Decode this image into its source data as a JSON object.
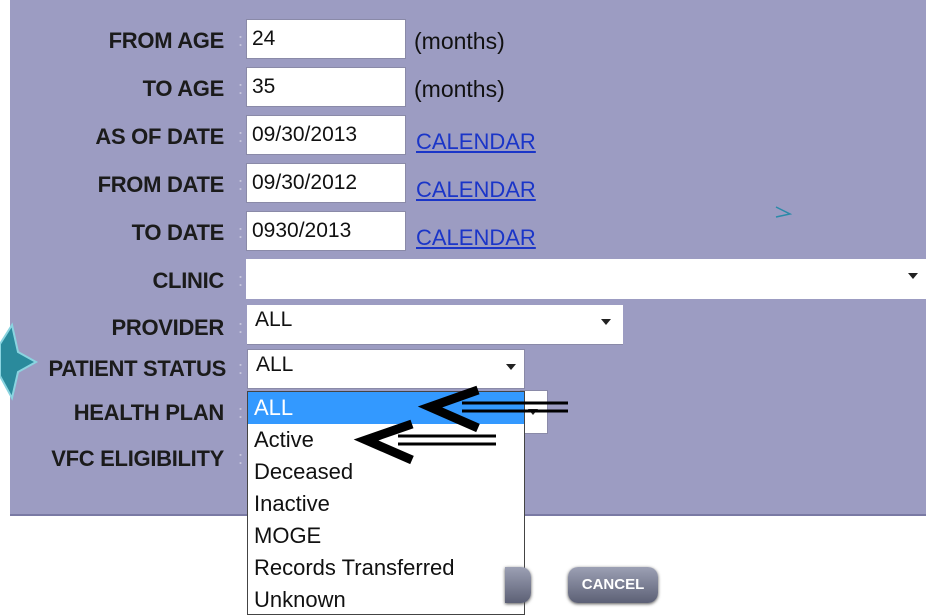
{
  "form": {
    "from_age": {
      "label": "FROM AGE",
      "value": "24",
      "unit": "(months)"
    },
    "to_age": {
      "label": "TO AGE",
      "value": "35",
      "unit": "(months)"
    },
    "as_of_date": {
      "label": "AS OF DATE",
      "value": "09/30/2013",
      "link": "CALENDAR"
    },
    "from_date": {
      "label": "FROM DATE",
      "value": "09/30/2012",
      "link": "CALENDAR"
    },
    "to_date": {
      "label": "TO DATE",
      "value": "0930/2013",
      "link": "CALENDAR"
    },
    "clinic": {
      "label": "CLINIC",
      "value": ""
    },
    "provider": {
      "label": "PROVIDER",
      "value": "ALL"
    },
    "patient_status": {
      "label": "PATIENT STATUS",
      "value": "ALL"
    },
    "health_plan": {
      "label": "HEALTH PLAN"
    },
    "vfc_eligibility": {
      "label": "VFC ELIGIBILITY"
    },
    "colon": ":"
  },
  "status_dropdown": {
    "options": [
      "ALL",
      "Active",
      "Deceased",
      "Inactive",
      "MOGE",
      "Records Transferred",
      "Unknown"
    ],
    "selected": "ALL",
    "highlight_color": "#3399ff"
  },
  "buttons": {
    "cancel": "CANCEL"
  },
  "colors": {
    "panel": "#9c9cc2",
    "link": "#1a35c8",
    "star": "#2a8a9c",
    "arrow": "#000000"
  },
  "annotations": {
    "icons": [
      "star-icon",
      "arrow-icon",
      "arrow-icon"
    ]
  }
}
